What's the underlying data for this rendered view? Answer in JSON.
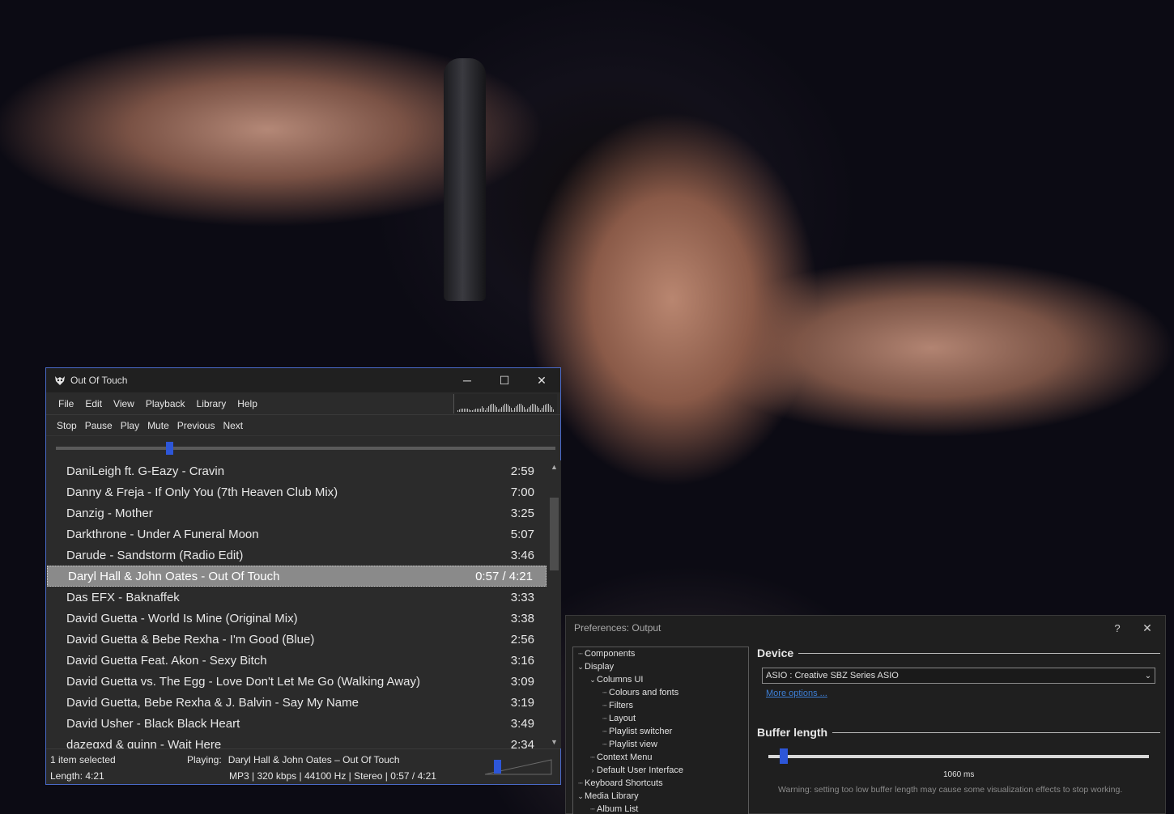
{
  "player": {
    "title": "Out Of Touch",
    "window_controls": {
      "minimize": "─",
      "maximize": "☐",
      "close": "✕"
    },
    "menu": [
      "File",
      "Edit",
      "View",
      "Playback",
      "Library",
      "Help"
    ],
    "toolbar": [
      "Stop",
      "Pause",
      "Play",
      "Mute",
      "Previous",
      "Next"
    ],
    "seek_position_fraction": 0.22,
    "playlist": [
      {
        "title": "DaniLeigh ft. G-Eazy - Cravin",
        "length": "2:59"
      },
      {
        "title": "Danny & Freja - If Only You (7th Heaven Club Mix)",
        "length": "7:00"
      },
      {
        "title": "Danzig - Mother",
        "length": "3:25"
      },
      {
        "title": "Darkthrone - Under A Funeral Moon",
        "length": "5:07"
      },
      {
        "title": "Darude - Sandstorm (Radio Edit)",
        "length": "3:46"
      },
      {
        "title": "Daryl Hall & John Oates - Out Of Touch",
        "length": "0:57 / 4:21",
        "playing": true
      },
      {
        "title": "Das EFX - Baknaffek",
        "length": "3:33"
      },
      {
        "title": "David Guetta - World Is Mine (Original Mix)",
        "length": "3:38"
      },
      {
        "title": "David Guetta & Bebe Rexha - I'm Good (Blue)",
        "length": "2:56"
      },
      {
        "title": "David Guetta Feat. Akon - Sexy Bitch",
        "length": "3:16"
      },
      {
        "title": "David Guetta vs. The Egg - Love Don't Let Me Go (Walking Away)",
        "length": "3:09"
      },
      {
        "title": "David Guetta, Bebe Rexha & J. Balvin - Say My Name",
        "length": "3:19"
      },
      {
        "title": "David Usher - Black Black Heart",
        "length": "3:49"
      },
      {
        "title": "dazegxd & quinn - Wait Here",
        "length": "2:34"
      }
    ],
    "status": {
      "selection": "1 item selected",
      "length": "Length: 4:21",
      "playing_label": "Playing:",
      "playing_track": "Daryl Hall & John Oates – Out Of Touch",
      "format": "MP3 | 320 kbps | 44100 Hz | Stereo | 0:57 / 4:21"
    },
    "volume_fraction": 0.15,
    "accent_color": "#2d56d8"
  },
  "prefs": {
    "title": "Preferences: Output",
    "help": "?",
    "close": "✕",
    "tree": [
      {
        "label": "Components",
        "level": 0,
        "toggle": ""
      },
      {
        "label": "Display",
        "level": 0,
        "toggle": "⌄"
      },
      {
        "label": "Columns UI",
        "level": 1,
        "toggle": "⌄"
      },
      {
        "label": "Colours and fonts",
        "level": 2,
        "toggle": ""
      },
      {
        "label": "Filters",
        "level": 2,
        "toggle": ""
      },
      {
        "label": "Layout",
        "level": 2,
        "toggle": ""
      },
      {
        "label": "Playlist switcher",
        "level": 2,
        "toggle": ""
      },
      {
        "label": "Playlist view",
        "level": 2,
        "toggle": ""
      },
      {
        "label": "Context Menu",
        "level": 1,
        "toggle": ""
      },
      {
        "label": "Default User Interface",
        "level": 1,
        "toggle": "›"
      },
      {
        "label": "Keyboard Shortcuts",
        "level": 0,
        "toggle": ""
      },
      {
        "label": "Media Library",
        "level": 0,
        "toggle": "⌄"
      },
      {
        "label": "Album List",
        "level": 1,
        "toggle": ""
      }
    ],
    "device_heading": "Device",
    "device_value": "ASIO : Creative SBZ Series ASIO",
    "more_options": "More options ...",
    "buffer_heading": "Buffer length",
    "buffer_value": "1060 ms",
    "buffer_fraction": 0.04,
    "warning": "Warning: setting too low buffer length may cause some visualization effects to stop working."
  }
}
